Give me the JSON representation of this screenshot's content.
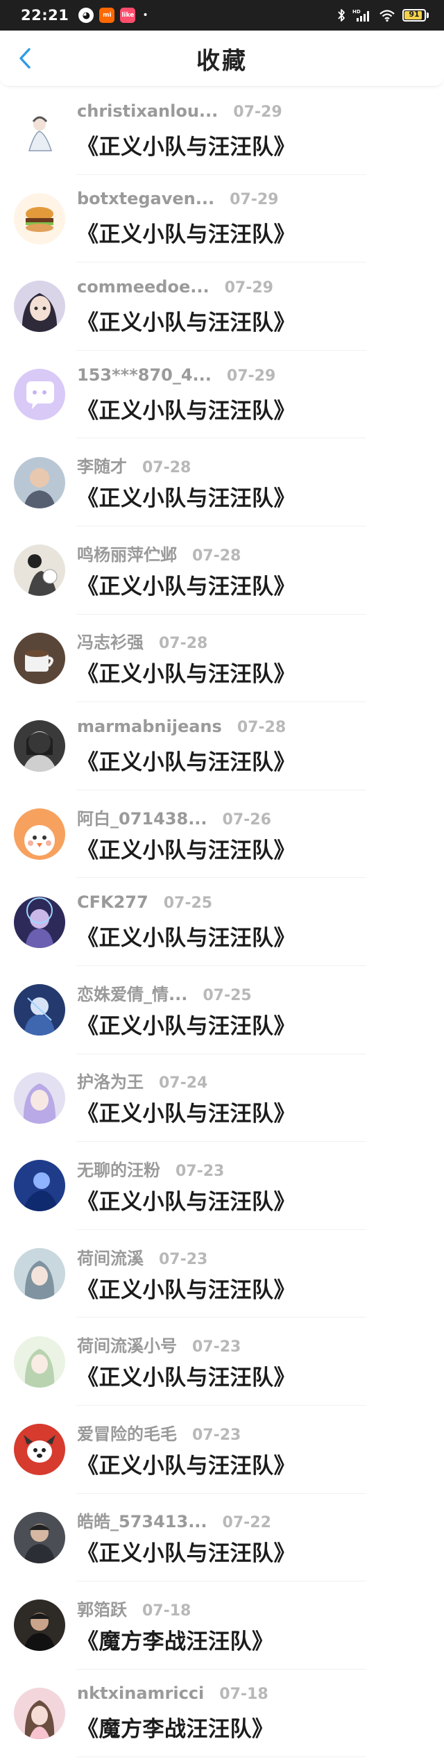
{
  "status_bar": {
    "time": "22:21",
    "apps": [
      "qq-icon",
      "mi-icon",
      "kuaishou-icon"
    ],
    "app_labels": [
      "",
      "mi",
      "like"
    ],
    "battery_level": "91",
    "network_label": "HD"
  },
  "header": {
    "title": "收藏",
    "back_icon": "chevron-left-icon"
  },
  "favorites": [
    {
      "name": "christixanlou...",
      "date": "07-29",
      "title": "《正义小队与汪汪队》",
      "avatar": "fairy-portrait",
      "avatar_bg": "#ffffff"
    },
    {
      "name": "botxtegaven...",
      "date": "07-29",
      "title": "《正义小队与汪汪队》",
      "avatar": "burger",
      "avatar_bg": "#fff4e6"
    },
    {
      "name": "commeedoe...",
      "date": "07-29",
      "title": "《正义小队与汪汪队》",
      "avatar": "anime-girl",
      "avatar_bg": "#d9d4e8"
    },
    {
      "name": "153***870_4...",
      "date": "07-29",
      "title": "《正义小队与汪汪队》",
      "avatar": "chat-bubble",
      "avatar_bg": "#d9c9f7"
    },
    {
      "name": "李随才",
      "date": "07-28",
      "title": "《正义小队与汪汪队》",
      "avatar": "man-photo",
      "avatar_bg": "#b9c7d4"
    },
    {
      "name": "鸣杨丽萍伫邺",
      "date": "07-28",
      "title": "《正义小队与汪汪队》",
      "avatar": "dancer-bw",
      "avatar_bg": "#e8e4dc"
    },
    {
      "name": "冯志衫强",
      "date": "07-28",
      "title": "《正义小队与汪汪队》",
      "avatar": "coffee-cup",
      "avatar_bg": "#5a4638"
    },
    {
      "name": "marmabnijeans",
      "date": "07-28",
      "title": "《正义小队与汪汪队》",
      "avatar": "sad-person-bw",
      "avatar_bg": "#3a3a3a"
    },
    {
      "name": "阿白_071438...",
      "date": "07-26",
      "title": "《正义小队与汪汪队》",
      "avatar": "cartoon-chick",
      "avatar_bg": "#f7a15f"
    },
    {
      "name": "CFK277",
      "date": "07-25",
      "title": "《正义小队与汪汪队》",
      "avatar": "anime-character",
      "avatar_bg": "#2d2a5a"
    },
    {
      "name": "恋姝爱倩_情...",
      "date": "07-25",
      "title": "《正义小队与汪汪队》",
      "avatar": "anime-warrior",
      "avatar_bg": "#243a6e"
    },
    {
      "name": "护洛为王",
      "date": "07-24",
      "title": "《正义小队与汪汪队》",
      "avatar": "anime-princess",
      "avatar_bg": "#e3e0f2"
    },
    {
      "name": "无聊的汪粉",
      "date": "07-23",
      "title": "《正义小队与汪汪队》",
      "avatar": "blue-night",
      "avatar_bg": "#1e3c8a"
    },
    {
      "name": "荷间流溪",
      "date": "07-23",
      "title": "《正义小队与汪汪队》",
      "avatar": "anime-maiden",
      "avatar_bg": "#c9d8de"
    },
    {
      "name": "荷间流溪小号",
      "date": "07-23",
      "title": "《正义小队与汪汪队》",
      "avatar": "anime-maiden-light",
      "avatar_bg": "#eaf3e4"
    },
    {
      "name": "爱冒险的毛毛",
      "date": "07-23",
      "title": "《正义小队与汪汪队》",
      "avatar": "pup-red",
      "avatar_bg": "#d63b2e"
    },
    {
      "name": "皓皓_573413...",
      "date": "07-22",
      "title": "《正义小队与汪汪队》",
      "avatar": "boy-dark",
      "avatar_bg": "#4b4f55"
    },
    {
      "name": "郭箔跃",
      "date": "07-18",
      "title": "《魔方李战汪汪队》",
      "avatar": "boy-photo",
      "avatar_bg": "#2e2a26"
    },
    {
      "name": "nktxinamricci",
      "date": "07-18",
      "title": "《魔方李战汪汪队》",
      "avatar": "girl-pink",
      "avatar_bg": "#f2d6dc"
    }
  ]
}
